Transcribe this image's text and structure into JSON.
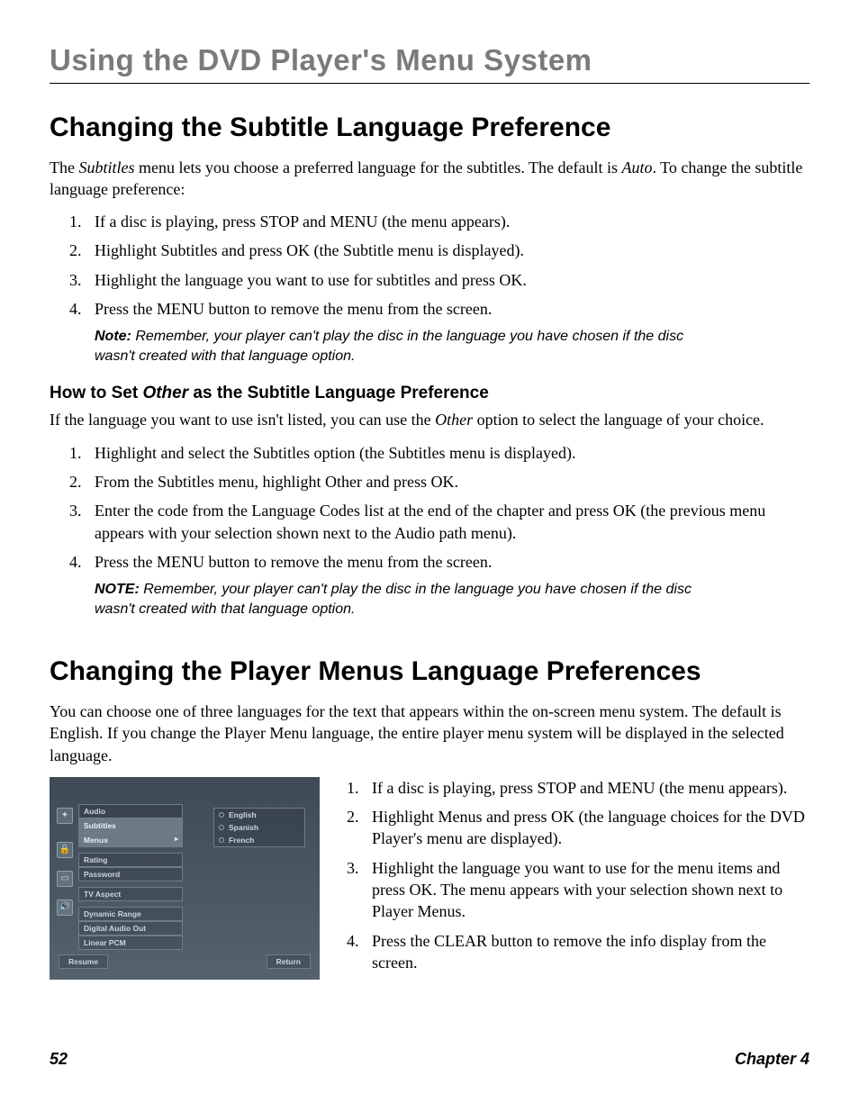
{
  "chapterTitle": "Using the DVD Player's Menu System",
  "sectionA": {
    "heading": "Changing the Subtitle Language Preference",
    "intro_pre": "The ",
    "intro_em1": "Subtitles",
    "intro_mid": " menu lets you choose a preferred language for the subtitles. The default is ",
    "intro_em2": "Auto",
    "intro_post": ". To change the subtitle language preference:",
    "steps": [
      {
        "pre": "If a disc is playing, press STOP and MENU (the menu appears)."
      },
      {
        "pre": "Highlight ",
        "em": "Subtitles",
        "mid": " and press OK (the ",
        "em2": "Subtitle",
        "post": " menu is displayed)."
      },
      {
        "pre": "Highlight the language you want to use for subtitles and press OK."
      },
      {
        "pre": "Press the MENU button to remove the menu from the screen."
      }
    ],
    "noteLabel": "Note:",
    "noteText": " Remember, your player can't play the disc in the language you have chosen if the disc wasn't created with that language option."
  },
  "sectionB": {
    "heading_pre": "How to Set ",
    "heading_em": "Other",
    "heading_post": " as the Subtitle Language Preference",
    "intro_pre": "If the language you want to use isn't listed, you can use the ",
    "intro_em": "Other",
    "intro_post": " option to select the language of your choice.",
    "steps": [
      {
        "pre": "Highlight and select the ",
        "em": "Subtitles",
        "post": " option (the Subtitles menu is displayed)."
      },
      {
        "pre": "From the ",
        "em": "Subtitles",
        "mid": " menu, highlight ",
        "em2": "Other",
        "post": " and press OK."
      },
      {
        "pre": "Enter the code from the Language Codes list at the end of the chapter and press OK (the previous menu appears with your selection shown next to the ",
        "em": "Audio",
        "post": " path menu)."
      },
      {
        "pre": "Press the MENU button to remove the menu from the screen."
      }
    ],
    "noteLabel": "NOTE:",
    "noteText": " Remember, your player can't play the disc in the language you have chosen if the disc wasn't created with that language option."
  },
  "sectionC": {
    "heading": "Changing the Player Menus Language Preferences",
    "intro": "You can choose one of three languages for the text that appears within the on-screen menu system. The default is English. If you change the Player Menu language, the entire player menu system will be displayed in the selected language.",
    "steps": [
      {
        "pre": "If a disc is playing, press STOP and MENU (the menu appears)."
      },
      {
        "pre": "Highlight ",
        "em": "Menus",
        "post": " and press OK (the language choices for the DVD Player's menu are displayed)."
      },
      {
        "pre": "Highlight the language you want to use for the menu items and press OK. The menu appears with your selection shown next to ",
        "em": "Player Menus",
        "post": "."
      },
      {
        "pre": "Press the CLEAR button to remove the info display from the screen."
      }
    ]
  },
  "screenshot": {
    "groups": [
      [
        "Audio",
        "Subtitles",
        "Menus"
      ],
      [
        "Rating",
        "Password"
      ],
      [
        "TV Aspect"
      ],
      [
        "Dynamic Range",
        "Digital Audio Out",
        "Linear PCM"
      ]
    ],
    "selected": "Menus",
    "options": [
      "English",
      "Spanish",
      "French"
    ],
    "resume": "Resume",
    "return": "Return"
  },
  "footer": {
    "page": "52",
    "chapter": "Chapter 4"
  }
}
